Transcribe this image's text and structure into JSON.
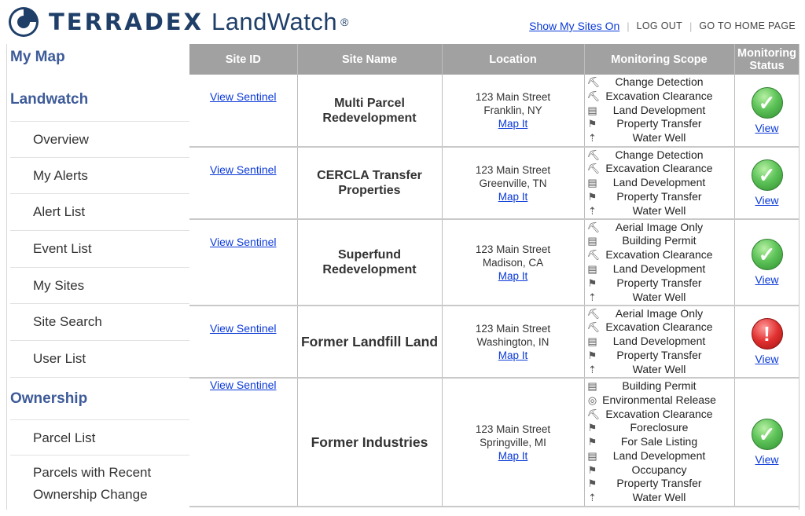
{
  "header": {
    "brand": "TERRADEX",
    "product": "LandWatch",
    "registered": "®",
    "links": {
      "show_sites": "Show My Sites On",
      "logout": "LOG OUT",
      "home": "GO TO HOME PAGE"
    },
    "brand_color": "#1f3f69"
  },
  "sidebar": {
    "my_map": "My Map",
    "landwatch_heading": "Landwatch",
    "landwatch_items": [
      "Overview",
      "My Alerts",
      "Alert List",
      "Event List",
      "My Sites",
      "Site Search",
      "User List"
    ],
    "ownership_heading": "Ownership",
    "ownership_items": [
      "Parcel List",
      "Parcels with Recent Ownership Change"
    ],
    "heading_color": "#3e5b99"
  },
  "table": {
    "columns": [
      "Site ID",
      "Site Name",
      "Location",
      "Monitoring Scope",
      "Monitoring Status"
    ],
    "rows": [
      {
        "site_id_link": "View Sentinel",
        "name": "Multi Parcel Redevelopment",
        "address": "123 Main Street",
        "city": "Franklin, NY",
        "map_link": "Map It",
        "scope": [
          {
            "icon": "excavator-icon",
            "label": "Change Detection"
          },
          {
            "icon": "excavator-icon",
            "label": "Excavation Clearance"
          },
          {
            "icon": "document-icon",
            "label": "Land Development"
          },
          {
            "icon": "flag-icon",
            "label": "Property Transfer"
          },
          {
            "icon": "well-icon",
            "label": "Water Well"
          }
        ],
        "status": "ok",
        "status_link": "View"
      },
      {
        "site_id_link": "View Sentinel",
        "name": "CERCLA Transfer Properties",
        "address": "123 Main Street",
        "city": "Greenville, TN",
        "map_link": "Map It",
        "scope": [
          {
            "icon": "excavator-icon",
            "label": "Change Detection"
          },
          {
            "icon": "excavator-icon",
            "label": "Excavation Clearance"
          },
          {
            "icon": "document-icon",
            "label": "Land Development"
          },
          {
            "icon": "flag-icon",
            "label": "Property Transfer"
          },
          {
            "icon": "well-icon",
            "label": "Water Well"
          }
        ],
        "status": "ok",
        "status_link": "View"
      },
      {
        "site_id_link": "View Sentinel",
        "name": "Superfund Redevelopment",
        "address": "123 Main Street",
        "city": "Madison, CA",
        "map_link": "Map It",
        "scope": [
          {
            "icon": "excavator-icon",
            "label": "Aerial Image Only"
          },
          {
            "icon": "document-icon",
            "label": "Building Permit"
          },
          {
            "icon": "excavator-icon",
            "label": "Excavation Clearance"
          },
          {
            "icon": "document-icon",
            "label": "Land Development"
          },
          {
            "icon": "flag-icon",
            "label": "Property Transfer"
          },
          {
            "icon": "well-icon",
            "label": "Water Well"
          }
        ],
        "status": "ok",
        "status_link": "View"
      },
      {
        "site_id_link": "View Sentinel",
        "name": "Former Landfill Land",
        "address": "123 Main Street",
        "city": "Washington, IN",
        "map_link": "Map It",
        "scope": [
          {
            "icon": "excavator-icon",
            "label": "Aerial Image Only"
          },
          {
            "icon": "excavator-icon",
            "label": "Excavation Clearance"
          },
          {
            "icon": "document-icon",
            "label": "Land Development"
          },
          {
            "icon": "flag-icon",
            "label": "Property Transfer"
          },
          {
            "icon": "well-icon",
            "label": "Water Well"
          }
        ],
        "status": "alert",
        "status_link": "View"
      },
      {
        "site_id_link": "View Sentinel",
        "name": "Former Industries",
        "address": "123 Main Street",
        "city": "Springville, MI",
        "map_link": "Map It",
        "scope": [
          {
            "icon": "document-icon",
            "label": "Building Permit"
          },
          {
            "icon": "target-icon",
            "label": "Environmental Release"
          },
          {
            "icon": "excavator-icon",
            "label": "Excavation Clearance"
          },
          {
            "icon": "flag-icon",
            "label": "Foreclosure"
          },
          {
            "icon": "flag-icon",
            "label": "For Sale Listing"
          },
          {
            "icon": "document-icon",
            "label": "Land Development"
          },
          {
            "icon": "flag-icon",
            "label": "Occupancy"
          },
          {
            "icon": "flag-icon",
            "label": "Property Transfer"
          },
          {
            "icon": "well-icon",
            "label": "Water Well"
          }
        ],
        "status": "ok",
        "status_link": "View"
      }
    ]
  }
}
